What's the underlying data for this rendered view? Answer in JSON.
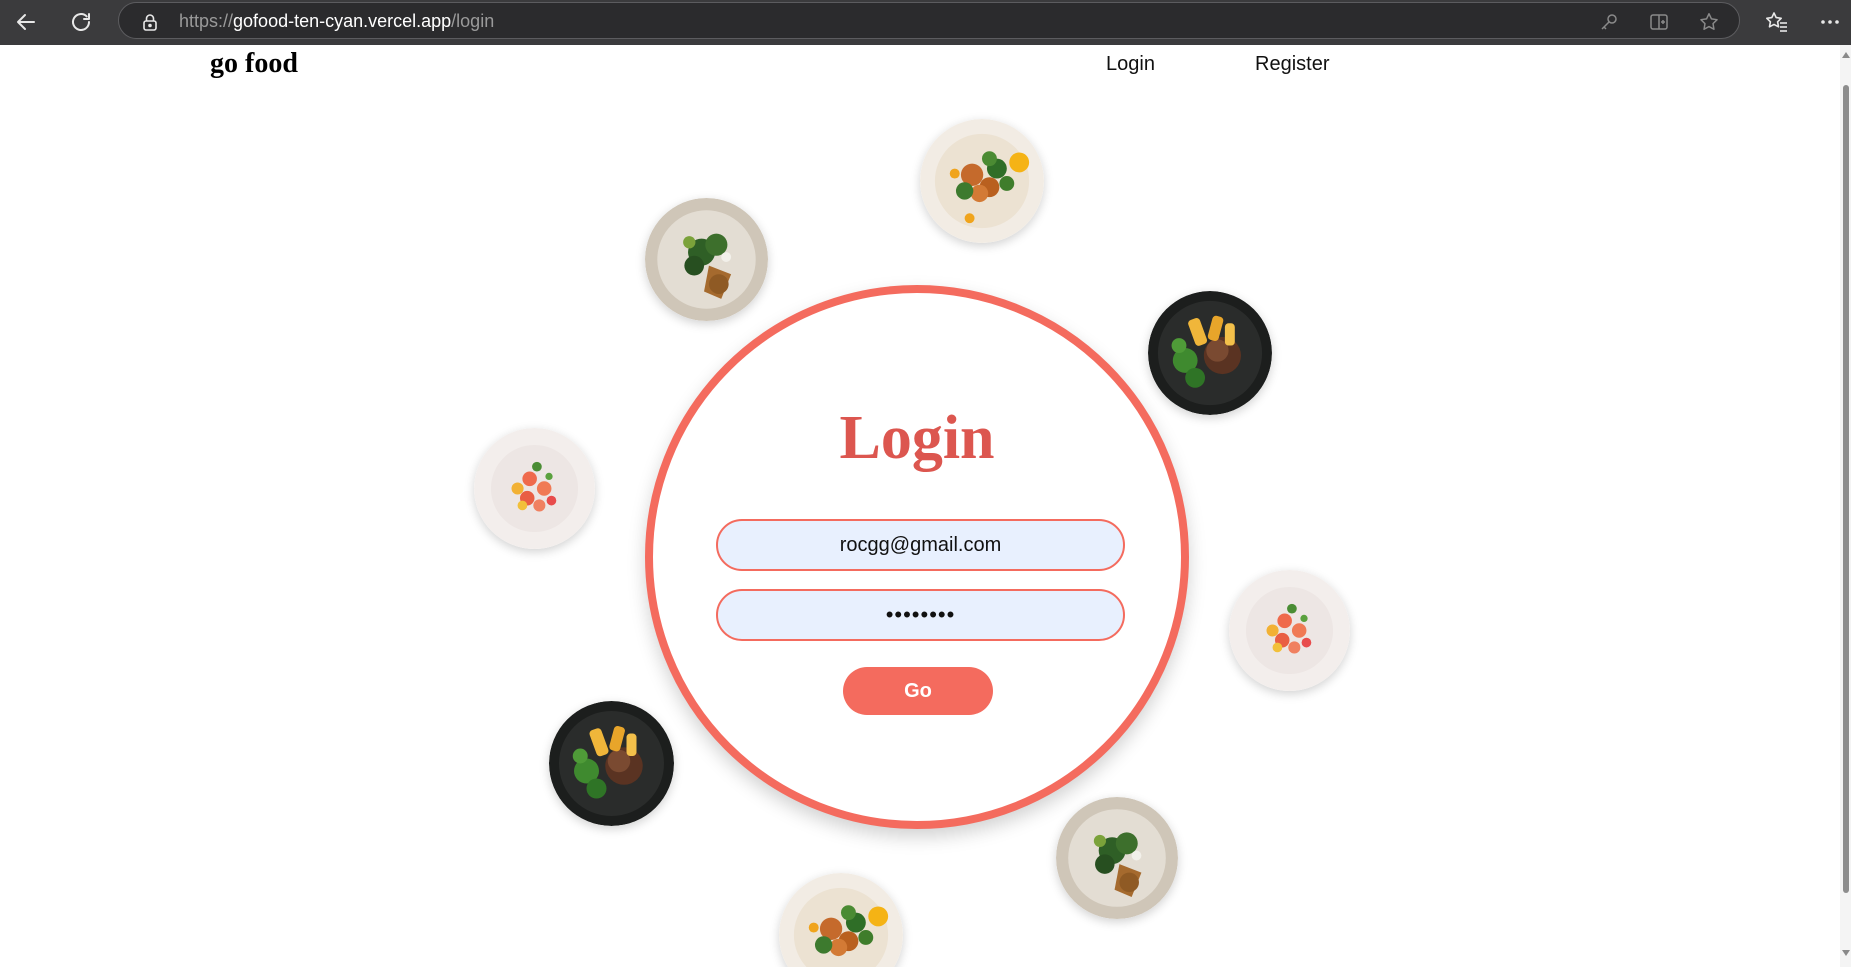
{
  "browser": {
    "url_prefix": "https://",
    "url_host": "gofood-ten-cyan.vercel.app",
    "url_path": "/login",
    "icons": [
      "back-arrow-icon",
      "refresh-icon",
      "lock-icon",
      "key-icon",
      "split-screen-icon",
      "star-icon",
      "favorites-icon",
      "more-icon"
    ]
  },
  "navbar": {
    "brand": "go food",
    "links": [
      {
        "label": "Login"
      },
      {
        "label": "Register"
      }
    ]
  },
  "login": {
    "title": "Login",
    "email_value": "rocgg@gmail.com",
    "password_value": "••••••••",
    "submit_label": "Go"
  },
  "decorations": {
    "plates": [
      "salad-plate-icon",
      "chicken-greens-plate-icon",
      "steak-fries-plate-icon",
      "shrimp-plate-icon"
    ]
  },
  "colors": {
    "accent": "#f46b5e",
    "title": "#dc564f",
    "input_bg": "#e8f0fe"
  }
}
